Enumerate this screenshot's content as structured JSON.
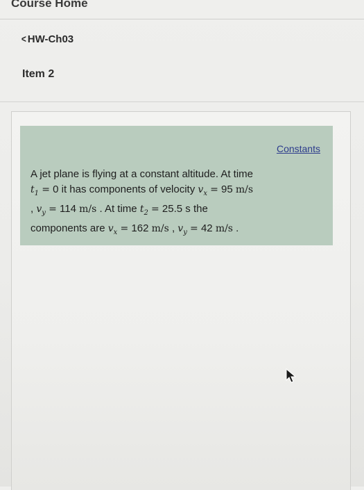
{
  "header": {
    "course_home": "Course Home"
  },
  "nav": {
    "back_chevron": "<",
    "back_label": "HW-Ch03"
  },
  "item": {
    "label": "Item 2"
  },
  "problem": {
    "constants_link": "Constants",
    "line1": "A jet plane is flying at a constant altitude. At time",
    "t1_var": "t",
    "t1_sub": "1",
    "eq": "=",
    "t1_value": "0",
    "line2_rest": "it has components of velocity",
    "vx_var": "v",
    "vx_sub": "x",
    "vx1_value": "95",
    "unit": "m/s",
    "comma": ",",
    "vy_var": "v",
    "vy_sub": "y",
    "vy1_value": "114",
    "period": ".",
    "at_time": "At time",
    "t2_var": "t",
    "t2_sub": "2",
    "t2_value": "25.5",
    "t2_unit": "s",
    "the": "the",
    "components_are": "components are",
    "vx2_value": "162",
    "vy2_value": "42"
  },
  "icons": {
    "cursor": "mouse-pointer-icon"
  },
  "colors": {
    "problem_background": "#b9ccbe",
    "link": "#2c3b8c"
  }
}
